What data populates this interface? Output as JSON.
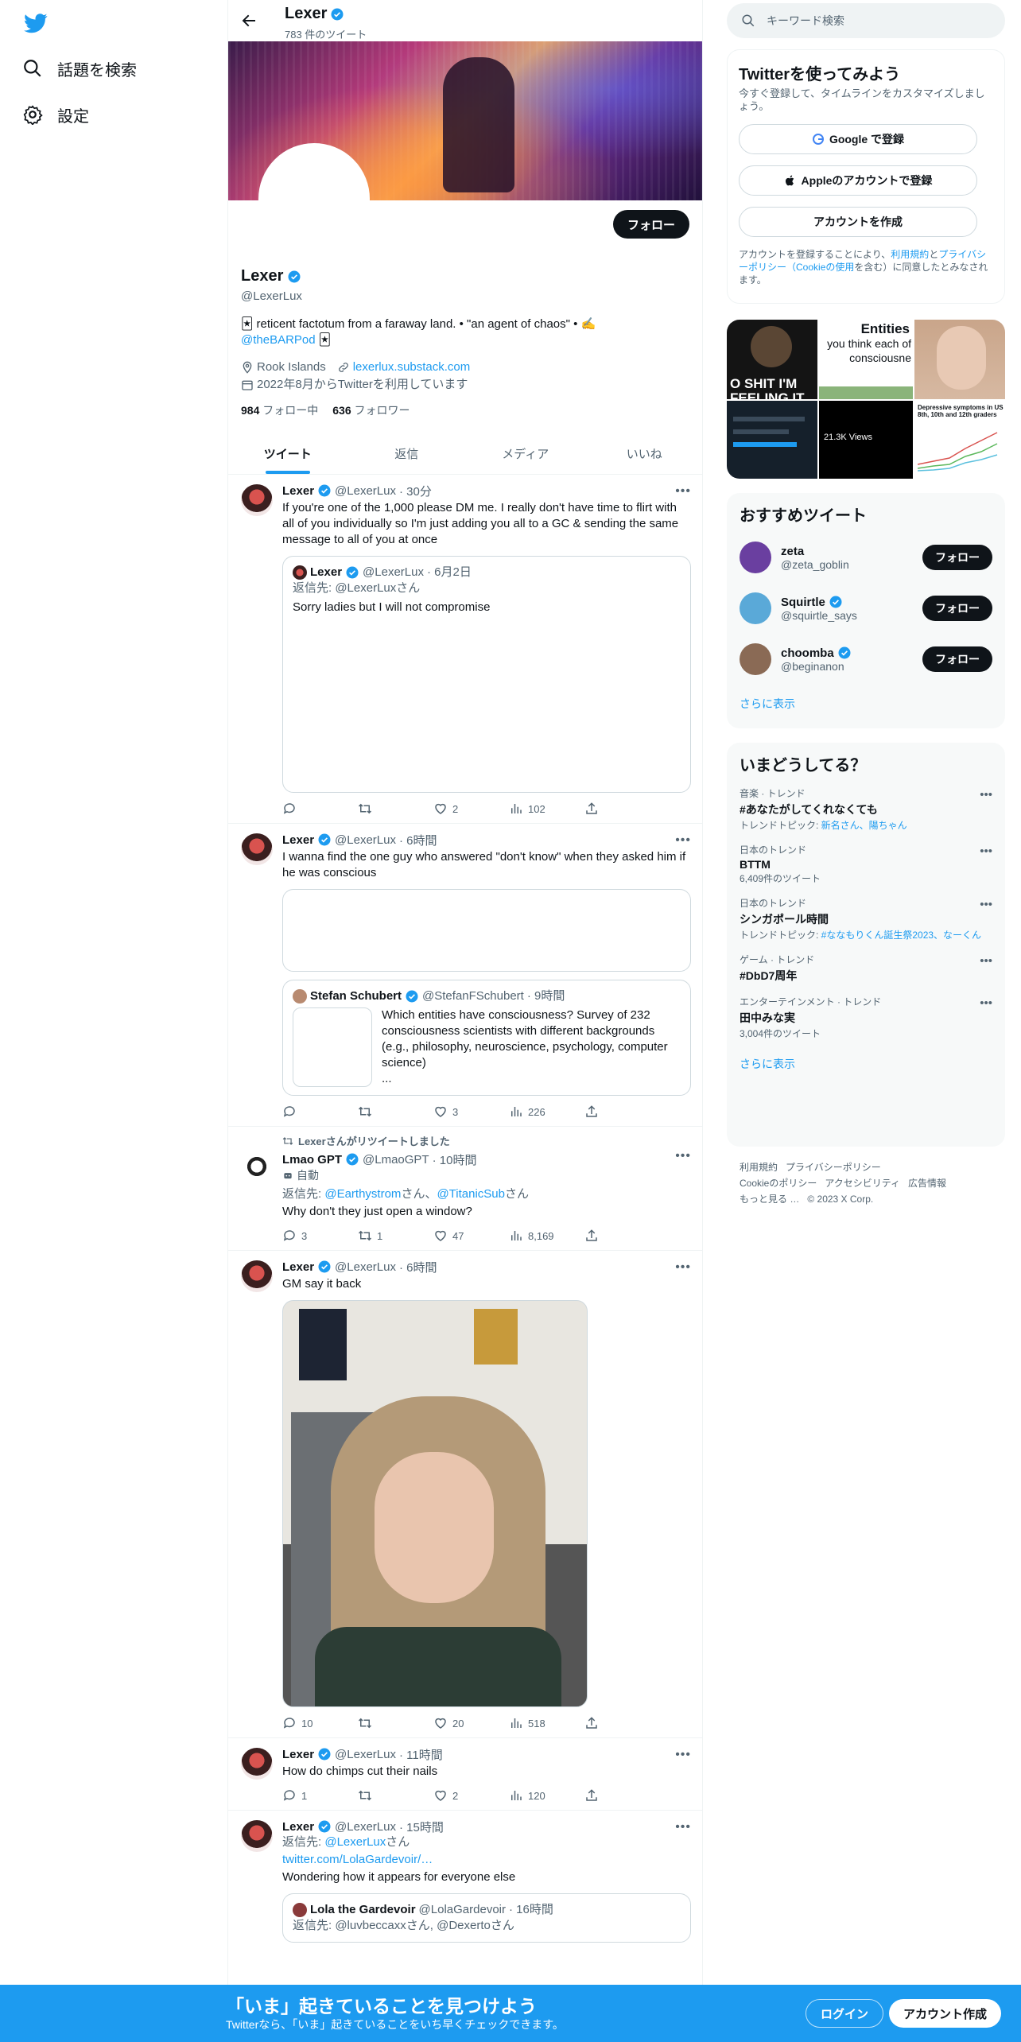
{
  "nav": {
    "explore": "話題を検索",
    "settings": "設定"
  },
  "topbar": {
    "name": "Lexer",
    "tweet_count": "783 件のツイート"
  },
  "profile": {
    "follow_label": "フォロー",
    "name": "Lexer",
    "handle": "@LexerLux",
    "bio_text": "🃏 reticent factotum from a faraway land. • \"an agent of chaos\" • ✍️",
    "bio_link": "@theBARPod",
    "bio_tail": "🃏",
    "location": "Rook Islands",
    "website": "lexerlux.substack.com",
    "joined": "2022年8月からTwitterを利用しています",
    "following_count": "984",
    "following_label": "フォロー中",
    "followers_count": "636",
    "followers_label": "フォロワー"
  },
  "tabs": [
    "ツイート",
    "返信",
    "メディア",
    "いいね"
  ],
  "tweets": [
    {
      "name": "Lexer",
      "handle": "@LexerLux",
      "time": "· 30分",
      "text": "If you're one of the 1,000 please DM me. I really don't have time to flirt with all of you individually so I'm just adding you all to a GC & sending the same message to all of you at once",
      "quote": {
        "name": "Lexer",
        "handle": "@LexerLux",
        "time": "· 6月2日",
        "reply_to": "返信先: @LexerLuxさん",
        "text": "Sorry ladies but I will not compromise"
      },
      "replies": "",
      "retweets": "",
      "likes": "2",
      "views": "102"
    },
    {
      "name": "Lexer",
      "handle": "@LexerLux",
      "time": "· 6時間",
      "text": "I wanna find the one guy who answered \"don't know\" when they asked him if he was conscious",
      "quote": {
        "name": "Stefan Schubert",
        "handle": "@StefanFSchubert",
        "time": "· 9時間",
        "text": "Which entities have consciousness? Survey of 232 consciousness scientists with different backgrounds (e.g., philosophy, neuroscience, psychology, computer science)",
        "ellipsis": "..."
      },
      "replies": "",
      "retweets": "",
      "likes": "3",
      "views": "226"
    },
    {
      "retweeted_by": "Lexerさんがリツイートしました",
      "name": "Lmao GPT",
      "handle": "@LmaoGPT",
      "time": "· 10時間",
      "automated": "自動",
      "reply_prefix": "返信先: ",
      "reply_user1": "@Earthystrom",
      "reply_mid": "さん、",
      "reply_user2": "@TitanicSub",
      "reply_suffix": "さん",
      "text": "Why don't they just open a window?",
      "replies": "3",
      "retweets": "1",
      "likes": "47",
      "views": "8,169"
    },
    {
      "name": "Lexer",
      "handle": "@LexerLux",
      "time": "· 6時間",
      "text": "GM say it back",
      "replies": "10",
      "retweets": "",
      "likes": "20",
      "views": "518"
    },
    {
      "name": "Lexer",
      "handle": "@LexerLux",
      "time": "· 11時間",
      "text": "How do chimps cut their nails",
      "replies": "1",
      "retweets": "",
      "likes": "2",
      "views": "120"
    },
    {
      "name": "Lexer",
      "handle": "@LexerLux",
      "time": "· 15時間",
      "reply_prefix": "返信先: ",
      "reply_user": "@LexerLux",
      "reply_suffix": "さん",
      "link": "twitter.com/LolaGardevoir/…",
      "text": "Wondering how it appears for everyone else",
      "quote": {
        "name": "Lola the Gardevoir",
        "handle": "@LolaGardevoir",
        "time": "· 16時間",
        "reply_to": "返信先: @luvbeccaxxさん, @Dexertoさん"
      }
    }
  ],
  "right": {
    "search_placeholder": "キーワード検索",
    "signup_title": "Twitterを使ってみよう",
    "signup_desc": "今すぐ登録して、タイムラインをカスタマイズしましょう。",
    "google_btn": "Google で登録",
    "apple_btn": "Appleのアカウントで登録",
    "create_btn": "アカウントを作成",
    "legal_a": "アカウントを登録することにより、",
    "legal_terms": "利用規約",
    "legal_b": "と",
    "legal_privacy": "プライバシーポリシー",
    "legal_cookie": "（Cookieの使用",
    "legal_c": "を含む）に同意したとみなされます。",
    "media_texts": {
      "m1a": "O SHIT I'M",
      "m1b": "FEELING IT",
      "m2a": "Entities",
      "m2b": "you think each of",
      "m2c": "consciousne",
      "m4": "21.3K Views",
      "m6": "Depressive symptoms in US 8th, 10th and 12th graders"
    },
    "reco_title": "おすすめツイート",
    "reco": [
      {
        "name": "zeta",
        "handle": "@zeta_goblin",
        "btn": "フォロー",
        "color": "#6a3fa0"
      },
      {
        "name": "Squirtle",
        "handle": "@squirtle_says",
        "btn": "フォロー",
        "color": "#5aa9d8"
      },
      {
        "name": "choomba",
        "handle": "@beginanon",
        "btn": "フォロー",
        "color": "#8a6a55"
      }
    ],
    "show_more": "さらに表示",
    "trend_title": "いまどうしてる？",
    "trends": [
      {
        "cat": "音楽 · トレンド",
        "name": "#あなたがしてくれなくても",
        "sub_label": "トレンドトピック: ",
        "sub_link": "新名さん、陽ちゃん"
      },
      {
        "cat": "日本のトレンド",
        "name": "BTTM",
        "sub": "6,409件のツイート"
      },
      {
        "cat": "日本のトレンド",
        "name": "シンガポール時間",
        "sub_label": "トレンドトピック: ",
        "sub_link": "#ななもりくん誕生祭2023、なーくん"
      },
      {
        "cat": "ゲーム · トレンド",
        "name": "#DbD7周年"
      },
      {
        "cat": "エンターテインメント · トレンド",
        "name": "田中みな実",
        "sub": "3,004件のツイート"
      }
    ],
    "footer": [
      "利用規約",
      "プライバシーポリシー",
      "Cookieのポリシー",
      "アクセシビリティ",
      "広告情報",
      "もっと見る …",
      "© 2023 X Corp."
    ]
  },
  "bottombar": {
    "title": "「いま」起きていることを見つけよう",
    "subtitle": "Twitterなら、「いま」起きていることをいち早くチェックできます。",
    "login": "ログイン",
    "signup": "アカウント作成"
  },
  "colors": {
    "accent": "#1d9bf0",
    "text": "#0f1419",
    "muted": "#536471"
  }
}
